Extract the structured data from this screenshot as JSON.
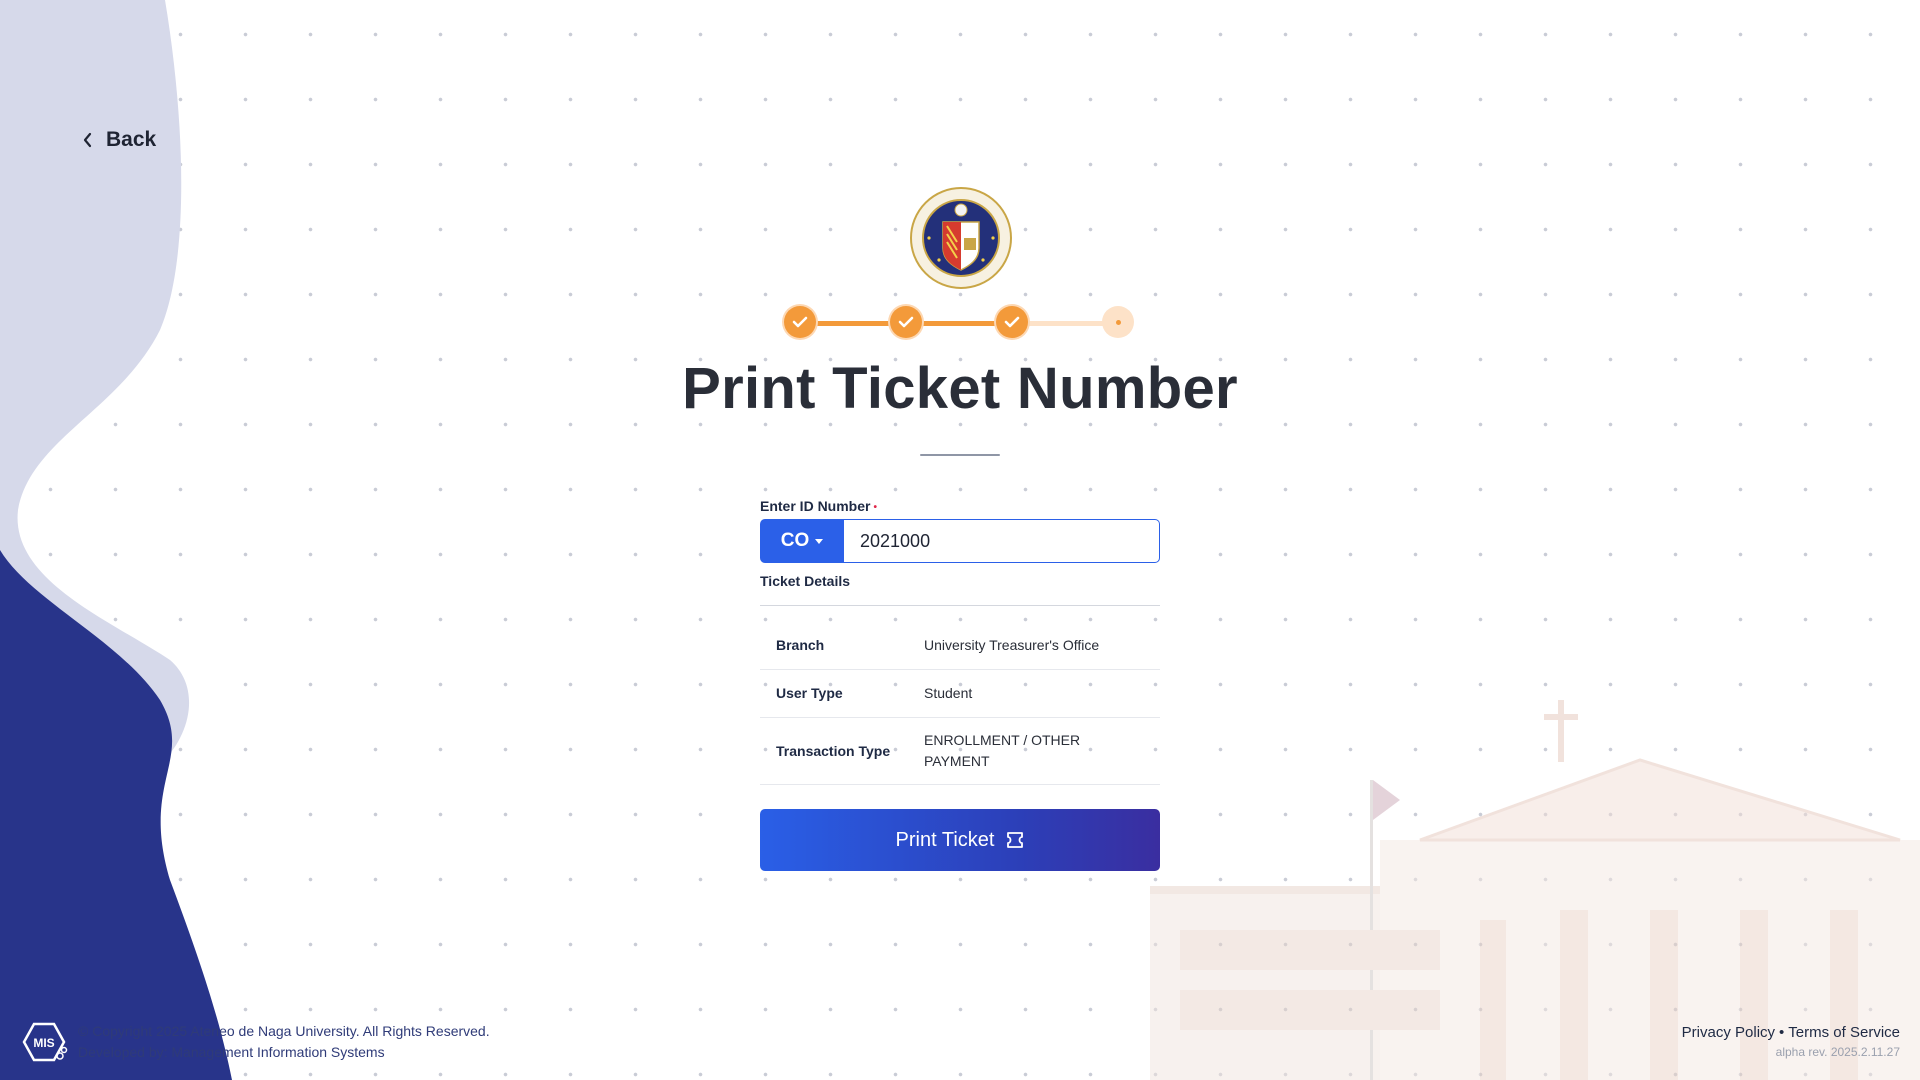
{
  "nav": {
    "back_label": "Back"
  },
  "stepper": {
    "steps": [
      "complete",
      "complete",
      "complete",
      "pending"
    ]
  },
  "page": {
    "title": "Print Ticket Number"
  },
  "form": {
    "id_label": "Enter ID Number",
    "required_marker": "•",
    "prefix": "CO",
    "id_value": "2021000",
    "details_label": "Ticket Details",
    "details": [
      {
        "key": "Branch",
        "value": "University Treasurer's Office"
      },
      {
        "key": "User Type",
        "value": "Student"
      },
      {
        "key": "Transaction Type",
        "value": "ENROLLMENT / OTHER PAYMENT"
      }
    ],
    "print_label": "Print Ticket"
  },
  "footer": {
    "copyright": "© Copyright 2025 Ateneo de Naga University. All Rights Reserved.",
    "developed_by": "Developed by: Management Information Systems",
    "privacy": "Privacy Policy",
    "separator": "•",
    "terms": "Terms of Service",
    "version": "alpha rev. 2025.2.11.27"
  },
  "colors": {
    "primary": "#2b60e8",
    "accent": "#f39a3a",
    "navy": "#28348a",
    "lavender": "#d5d8ea"
  }
}
